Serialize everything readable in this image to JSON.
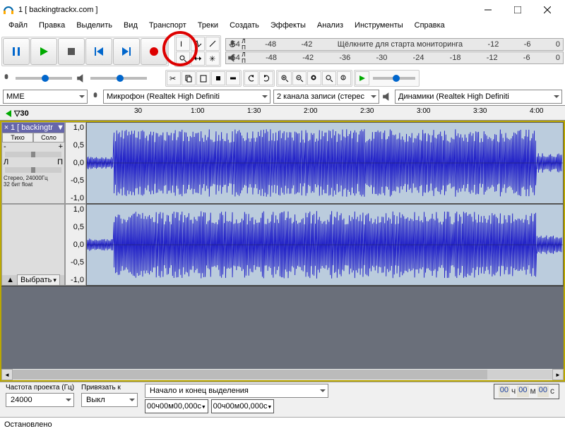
{
  "title": "1 [ backingtrackx.com ]",
  "menu": [
    "Файл",
    "Правка",
    "Выделить",
    "Вид",
    "Транспорт",
    "Треки",
    "Создать",
    "Эффекты",
    "Анализ",
    "Инструменты",
    "Справка"
  ],
  "transport": {
    "pause": "pause",
    "play": "play",
    "stop": "stop",
    "skip_start": "skip-start",
    "skip_end": "skip-end",
    "record": "record"
  },
  "meter": {
    "rec_msg": "Щёлкните для старта мониторинга",
    "ticks": [
      "-54",
      "-48",
      "-42",
      "",
      "",
      "",
      "-12",
      "-6",
      "0"
    ],
    "pb_ticks": [
      "-54",
      "-48",
      "-42",
      "-36",
      "-30",
      "-24",
      "-18",
      "-12",
      "-6",
      "0"
    ],
    "ch": "Л\nП"
  },
  "device": {
    "host": "MME",
    "input": "Микрофон (Realtek High Definiti",
    "channels": "2 канала записи (стерес",
    "output": "Динамики (Realtek High Definiti"
  },
  "timeline": {
    "start_label": "▷30",
    "major": [
      "30",
      "1:00",
      "1:30",
      "2:00",
      "2:30",
      "3:00",
      "3:30",
      "4:00"
    ]
  },
  "track": {
    "name": "1 [ backingtr",
    "mute": "Тихо",
    "solo": "Соло",
    "gain_minus": "-",
    "gain_plus": "+",
    "pan_l": "Л",
    "pan_r": "П",
    "info": "Стерео, 24000Гц\n32 бит float",
    "collapse": "▲",
    "select": "Выбрать",
    "vscale": [
      "1,0",
      "0,5",
      "0,0",
      "-0,5",
      "-1,0"
    ]
  },
  "bottom": {
    "rate_label": "Частота проекта (Гц)",
    "rate_value": "24000",
    "snap_label": "Привязать к",
    "snap_value": "Выкл",
    "sel_label": "Начало и конец выделения",
    "sel_start": "00ч00м00,000с",
    "sel_end": "00ч00м00,000с",
    "big_h": "00",
    "big_h_u": "ч",
    "big_m": "00",
    "big_m_u": "м",
    "big_s": "00",
    "big_s_u": "с"
  },
  "status": "Остановлено"
}
